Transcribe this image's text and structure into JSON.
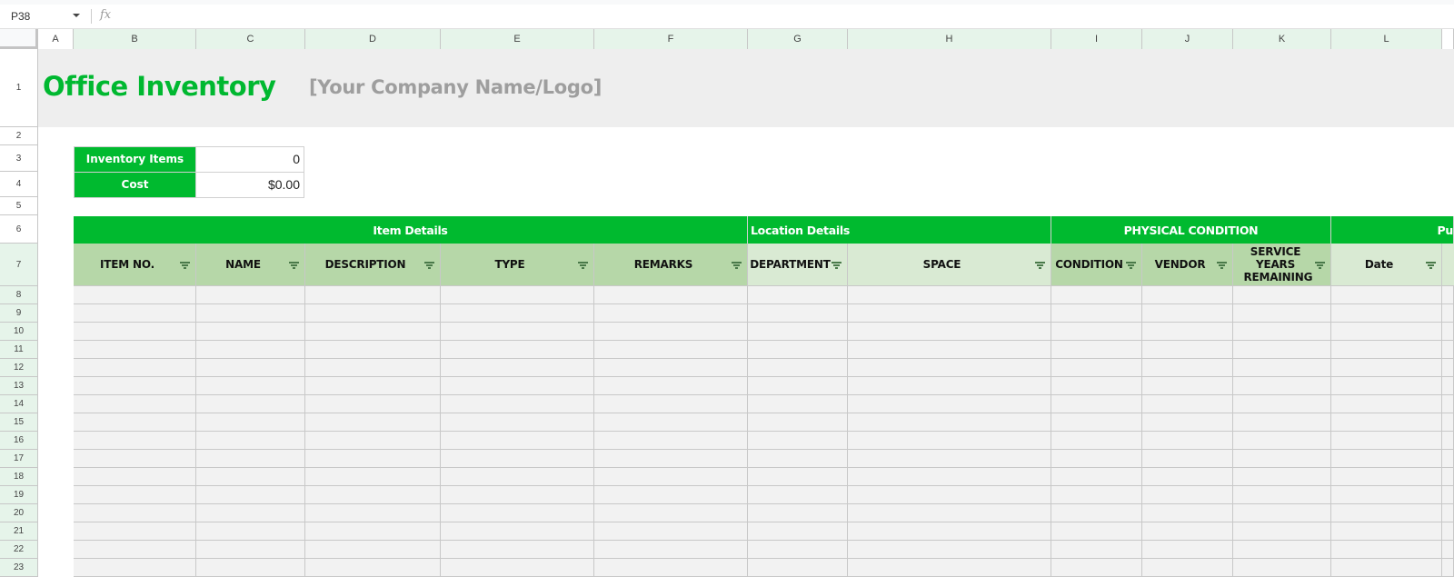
{
  "formula_bar": {
    "name_box": "P38",
    "fx_label": "fx",
    "formula": ""
  },
  "columns": [
    "A",
    "B",
    "C",
    "D",
    "E",
    "F",
    "G",
    "H",
    "I",
    "J",
    "K",
    "L",
    ""
  ],
  "rows": [
    "1",
    "2",
    "3",
    "4",
    "5",
    "6",
    "7",
    "8",
    "9",
    "10",
    "11",
    "12",
    "13",
    "14",
    "15",
    "16",
    "17",
    "18",
    "19",
    "20",
    "21",
    "22",
    "23"
  ],
  "sheet": {
    "title": "Office Inventory",
    "company": "[Your Company Name/Logo]",
    "summary": [
      {
        "label": "Inventory Items",
        "value": "0"
      },
      {
        "label": "Cost",
        "value": "$0.00"
      }
    ],
    "groups": [
      {
        "label": "Item Details"
      },
      {
        "label": "Location Details"
      },
      {
        "label": "PHYSICAL CONDITION"
      },
      {
        "label": "Pu"
      }
    ],
    "headers": [
      {
        "label": "ITEM NO."
      },
      {
        "label": "NAME"
      },
      {
        "label": "DESCRIPTION"
      },
      {
        "label": "TYPE"
      },
      {
        "label": "REMARKS"
      },
      {
        "label": "DEPARTMENT"
      },
      {
        "label": "SPACE"
      },
      {
        "label": "CONDITION"
      },
      {
        "label": "VENDOR"
      },
      {
        "label": "SERVICE YEARS REMAINING"
      },
      {
        "label": "Date"
      }
    ],
    "colors": {
      "accent_green": "#00ba2f",
      "header_dark": "#b6d7a8",
      "header_light": "#d9ead3",
      "company_gray": "#9e9e9e"
    }
  }
}
